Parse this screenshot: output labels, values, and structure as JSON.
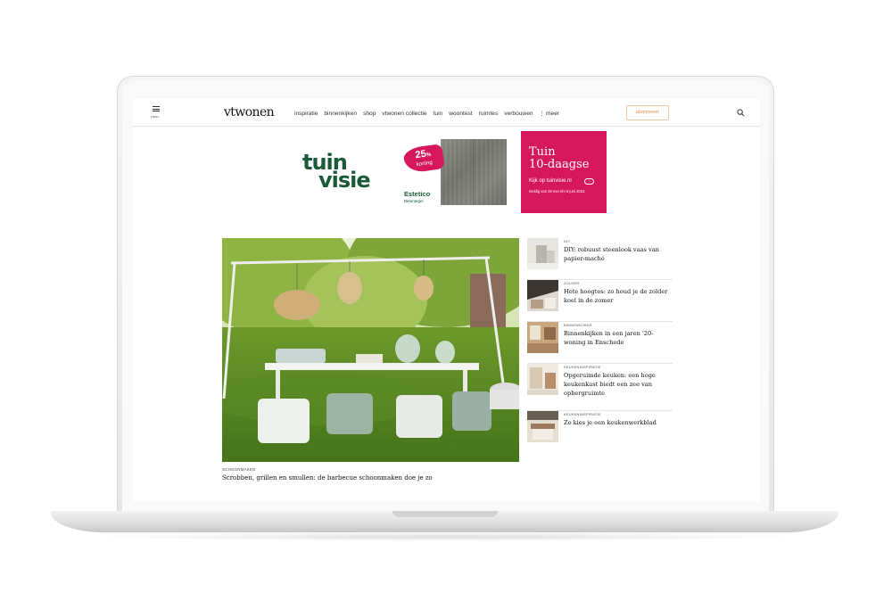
{
  "header": {
    "menu_label": "MENU",
    "logo": "vtwonen",
    "nav": [
      "inspiratie",
      "binnenkijken",
      "shop",
      "vtwonen collectie",
      "tuin",
      "woontest",
      "ruimtes",
      "verbouwen"
    ],
    "more_label": "meer",
    "subscribe_label": "abonneren"
  },
  "ad": {
    "logo_line1": "tuin",
    "logo_line2": "visie",
    "discount_pct": "25",
    "discount_unit": "%",
    "discount_label": "korting",
    "product_name": "Estetico",
    "product_sub": "Betontegel",
    "promo_title_1": "Tuin",
    "promo_title_2": "10-daagse",
    "promo_cta": "Kijk op tuinvisie.nl",
    "promo_valid": "Geldig van 26 mei t/m 5 juni 2023.",
    "accent_color": "#d6175c",
    "brand_color": "#1b5a37"
  },
  "hero": {
    "category": "SCHOONMAKEN",
    "title": "Scrobben, grillen en smullen: de barbecue schoonmaken doe je zo"
  },
  "side_articles": [
    {
      "category": "DIY",
      "title": "DIY: robuust steenlook vaas van papier-maché"
    },
    {
      "category": "ZOLDER",
      "title": "Hete hoogtes: zo houd je de zolder koel in de zomer"
    },
    {
      "category": "BINNENKIJKEN",
      "title": "Binnenkijken in een jaren '20-woning in Enschede"
    },
    {
      "category": "KEUKENINSPIRATIE",
      "title": "Opgeruimde keuken: een hoge keukenkast biedt een zee van opbergruimte"
    },
    {
      "category": "KEUKENINSPIRATIE",
      "title": "Zo kies je een keukenwerkblad"
    }
  ]
}
